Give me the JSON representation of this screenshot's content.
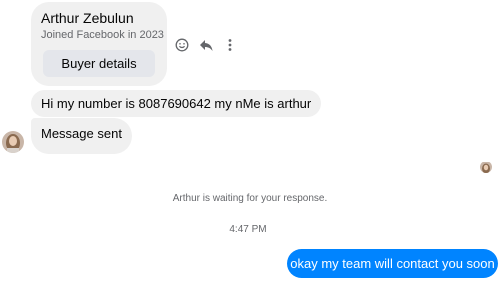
{
  "contact_card": {
    "name": "Arthur Zebulun",
    "joined": "Joined Facebook in 2023",
    "button_label": "Buyer details"
  },
  "message_actions": {
    "icons": [
      "smiley-icon",
      "reply-icon",
      "more-options-icon"
    ]
  },
  "messages": [
    {
      "sender": "Arthur Zebulun",
      "text": "Hi my number is 8087690642 my nMe is arthur"
    },
    {
      "sender": "Arthur Zebulun",
      "text": "Message sent"
    }
  ],
  "status_text": "Arthur is waiting for your response.",
  "timestamp": "4:47 PM",
  "outgoing_message": "okay my team will contact you soon",
  "colors": {
    "incoming_bubble": "#f0f0f0",
    "outgoing_bubble": "#0084ff",
    "secondary_text": "#65676b"
  }
}
